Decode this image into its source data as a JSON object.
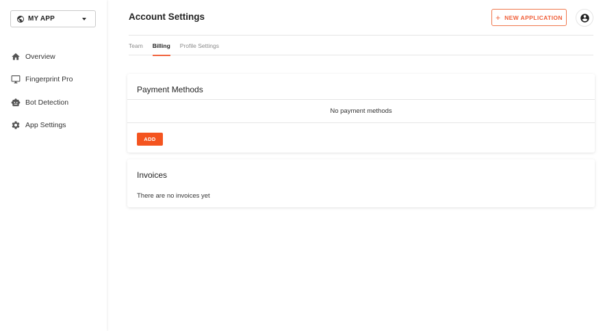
{
  "sidebar": {
    "app_selector": {
      "label": "MY APP",
      "icon": "globe-icon"
    },
    "items": [
      {
        "label": "Overview",
        "icon": "home-icon"
      },
      {
        "label": "Fingerprint Pro",
        "icon": "monitor-icon"
      },
      {
        "label": "Bot Detection",
        "icon": "robot-icon"
      },
      {
        "label": "App Settings",
        "icon": "gear-icon"
      }
    ]
  },
  "header": {
    "title": "Account Settings",
    "new_application_label": "NEW APPLICATION",
    "account_icon": "account-circle-icon"
  },
  "tabs": [
    {
      "label": "Team",
      "active": false
    },
    {
      "label": "Billing",
      "active": true
    },
    {
      "label": "Profile Settings",
      "active": false
    }
  ],
  "payment_methods": {
    "title": "Payment Methods",
    "empty_text": "No payment methods",
    "add_label": "ADD"
  },
  "invoices": {
    "title": "Invoices",
    "empty_text": "There are no invoices yet"
  },
  "colors": {
    "accent": "#f4541f",
    "accent_outline": "#f0603a",
    "text_primary": "#222222",
    "text_muted": "#8a8a8a"
  }
}
